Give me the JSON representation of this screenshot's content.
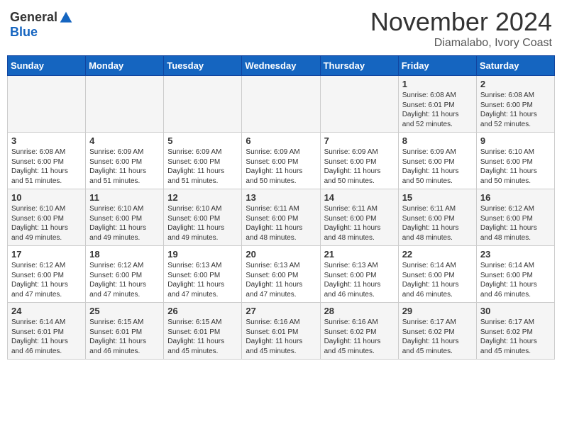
{
  "header": {
    "logo_general": "General",
    "logo_blue": "Blue",
    "month": "November 2024",
    "location": "Diamalabo, Ivory Coast"
  },
  "weekdays": [
    "Sunday",
    "Monday",
    "Tuesday",
    "Wednesday",
    "Thursday",
    "Friday",
    "Saturday"
  ],
  "weeks": [
    [
      {
        "day": "",
        "sunrise": "",
        "sunset": "",
        "daylight": ""
      },
      {
        "day": "",
        "sunrise": "",
        "sunset": "",
        "daylight": ""
      },
      {
        "day": "",
        "sunrise": "",
        "sunset": "",
        "daylight": ""
      },
      {
        "day": "",
        "sunrise": "",
        "sunset": "",
        "daylight": ""
      },
      {
        "day": "",
        "sunrise": "",
        "sunset": "",
        "daylight": ""
      },
      {
        "day": "1",
        "sunrise": "Sunrise: 6:08 AM",
        "sunset": "Sunset: 6:01 PM",
        "daylight": "Daylight: 11 hours and 52 minutes."
      },
      {
        "day": "2",
        "sunrise": "Sunrise: 6:08 AM",
        "sunset": "Sunset: 6:00 PM",
        "daylight": "Daylight: 11 hours and 52 minutes."
      }
    ],
    [
      {
        "day": "3",
        "sunrise": "Sunrise: 6:08 AM",
        "sunset": "Sunset: 6:00 PM",
        "daylight": "Daylight: 11 hours and 51 minutes."
      },
      {
        "day": "4",
        "sunrise": "Sunrise: 6:09 AM",
        "sunset": "Sunset: 6:00 PM",
        "daylight": "Daylight: 11 hours and 51 minutes."
      },
      {
        "day": "5",
        "sunrise": "Sunrise: 6:09 AM",
        "sunset": "Sunset: 6:00 PM",
        "daylight": "Daylight: 11 hours and 51 minutes."
      },
      {
        "day": "6",
        "sunrise": "Sunrise: 6:09 AM",
        "sunset": "Sunset: 6:00 PM",
        "daylight": "Daylight: 11 hours and 50 minutes."
      },
      {
        "day": "7",
        "sunrise": "Sunrise: 6:09 AM",
        "sunset": "Sunset: 6:00 PM",
        "daylight": "Daylight: 11 hours and 50 minutes."
      },
      {
        "day": "8",
        "sunrise": "Sunrise: 6:09 AM",
        "sunset": "Sunset: 6:00 PM",
        "daylight": "Daylight: 11 hours and 50 minutes."
      },
      {
        "day": "9",
        "sunrise": "Sunrise: 6:10 AM",
        "sunset": "Sunset: 6:00 PM",
        "daylight": "Daylight: 11 hours and 50 minutes."
      }
    ],
    [
      {
        "day": "10",
        "sunrise": "Sunrise: 6:10 AM",
        "sunset": "Sunset: 6:00 PM",
        "daylight": "Daylight: 11 hours and 49 minutes."
      },
      {
        "day": "11",
        "sunrise": "Sunrise: 6:10 AM",
        "sunset": "Sunset: 6:00 PM",
        "daylight": "Daylight: 11 hours and 49 minutes."
      },
      {
        "day": "12",
        "sunrise": "Sunrise: 6:10 AM",
        "sunset": "Sunset: 6:00 PM",
        "daylight": "Daylight: 11 hours and 49 minutes."
      },
      {
        "day": "13",
        "sunrise": "Sunrise: 6:11 AM",
        "sunset": "Sunset: 6:00 PM",
        "daylight": "Daylight: 11 hours and 48 minutes."
      },
      {
        "day": "14",
        "sunrise": "Sunrise: 6:11 AM",
        "sunset": "Sunset: 6:00 PM",
        "daylight": "Daylight: 11 hours and 48 minutes."
      },
      {
        "day": "15",
        "sunrise": "Sunrise: 6:11 AM",
        "sunset": "Sunset: 6:00 PM",
        "daylight": "Daylight: 11 hours and 48 minutes."
      },
      {
        "day": "16",
        "sunrise": "Sunrise: 6:12 AM",
        "sunset": "Sunset: 6:00 PM",
        "daylight": "Daylight: 11 hours and 48 minutes."
      }
    ],
    [
      {
        "day": "17",
        "sunrise": "Sunrise: 6:12 AM",
        "sunset": "Sunset: 6:00 PM",
        "daylight": "Daylight: 11 hours and 47 minutes."
      },
      {
        "day": "18",
        "sunrise": "Sunrise: 6:12 AM",
        "sunset": "Sunset: 6:00 PM",
        "daylight": "Daylight: 11 hours and 47 minutes."
      },
      {
        "day": "19",
        "sunrise": "Sunrise: 6:13 AM",
        "sunset": "Sunset: 6:00 PM",
        "daylight": "Daylight: 11 hours and 47 minutes."
      },
      {
        "day": "20",
        "sunrise": "Sunrise: 6:13 AM",
        "sunset": "Sunset: 6:00 PM",
        "daylight": "Daylight: 11 hours and 47 minutes."
      },
      {
        "day": "21",
        "sunrise": "Sunrise: 6:13 AM",
        "sunset": "Sunset: 6:00 PM",
        "daylight": "Daylight: 11 hours and 46 minutes."
      },
      {
        "day": "22",
        "sunrise": "Sunrise: 6:14 AM",
        "sunset": "Sunset: 6:00 PM",
        "daylight": "Daylight: 11 hours and 46 minutes."
      },
      {
        "day": "23",
        "sunrise": "Sunrise: 6:14 AM",
        "sunset": "Sunset: 6:00 PM",
        "daylight": "Daylight: 11 hours and 46 minutes."
      }
    ],
    [
      {
        "day": "24",
        "sunrise": "Sunrise: 6:14 AM",
        "sunset": "Sunset: 6:01 PM",
        "daylight": "Daylight: 11 hours and 46 minutes."
      },
      {
        "day": "25",
        "sunrise": "Sunrise: 6:15 AM",
        "sunset": "Sunset: 6:01 PM",
        "daylight": "Daylight: 11 hours and 46 minutes."
      },
      {
        "day": "26",
        "sunrise": "Sunrise: 6:15 AM",
        "sunset": "Sunset: 6:01 PM",
        "daylight": "Daylight: 11 hours and 45 minutes."
      },
      {
        "day": "27",
        "sunrise": "Sunrise: 6:16 AM",
        "sunset": "Sunset: 6:01 PM",
        "daylight": "Daylight: 11 hours and 45 minutes."
      },
      {
        "day": "28",
        "sunrise": "Sunrise: 6:16 AM",
        "sunset": "Sunset: 6:02 PM",
        "daylight": "Daylight: 11 hours and 45 minutes."
      },
      {
        "day": "29",
        "sunrise": "Sunrise: 6:17 AM",
        "sunset": "Sunset: 6:02 PM",
        "daylight": "Daylight: 11 hours and 45 minutes."
      },
      {
        "day": "30",
        "sunrise": "Sunrise: 6:17 AM",
        "sunset": "Sunset: 6:02 PM",
        "daylight": "Daylight: 11 hours and 45 minutes."
      }
    ]
  ]
}
